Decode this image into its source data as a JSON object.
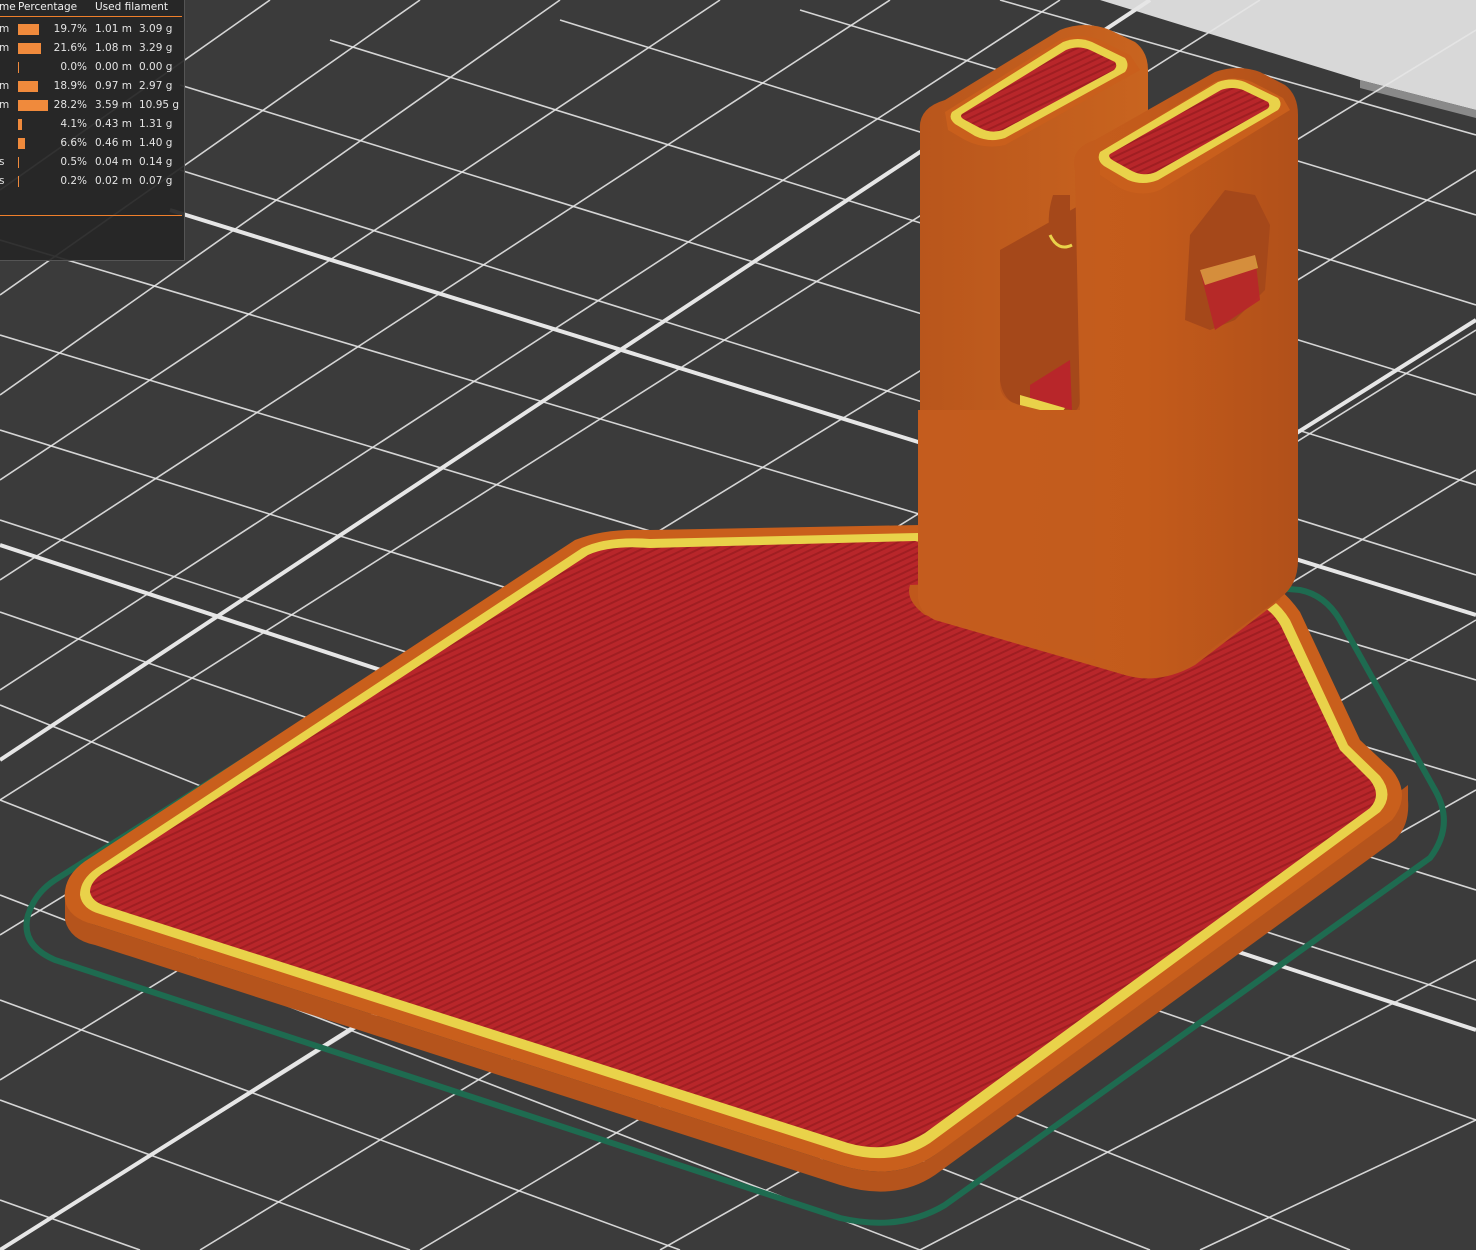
{
  "stats_panel": {
    "columns": {
      "time_partial": "me",
      "percentage": "Percentage",
      "used_filament": "Used filament"
    },
    "rows": [
      {
        "prefix": "m",
        "percentage": "19.7%",
        "length": "1.01 m",
        "weight": "3.09 g",
        "fraction": 0.197
      },
      {
        "prefix": "m",
        "percentage": "21.6%",
        "length": "1.08 m",
        "weight": "3.29 g",
        "fraction": 0.216
      },
      {
        "prefix": "",
        "percentage": "0.0%",
        "length": "0.00 m",
        "weight": "0.00 g",
        "fraction": 0.0
      },
      {
        "prefix": "m",
        "percentage": "18.9%",
        "length": "0.97 m",
        "weight": "2.97 g",
        "fraction": 0.189
      },
      {
        "prefix": "m",
        "percentage": "28.2%",
        "length": "3.59 m",
        "weight": "10.95 g",
        "fraction": 0.282
      },
      {
        "prefix": "",
        "percentage": "4.1%",
        "length": "0.43 m",
        "weight": "1.31 g",
        "fraction": 0.041
      },
      {
        "prefix": "",
        "percentage": "6.6%",
        "length": "0.46 m",
        "weight": "1.40 g",
        "fraction": 0.066
      },
      {
        "prefix": "s",
        "percentage": "0.5%",
        "length": "0.04 m",
        "weight": "0.14 g",
        "fraction": 0.005
      },
      {
        "prefix": "s",
        "percentage": "0.2%",
        "length": "0.02 m",
        "weight": "0.07 g",
        "fraction": 0.002
      }
    ]
  },
  "colors": {
    "bed": "#3b3b3b",
    "grid_line": "#e8e8e8",
    "perimeter": "#c95f1c",
    "perimeter_dark": "#a84c14",
    "inner_wall": "#e9d24a",
    "solid_infill": "#b8262a",
    "skirt": "#1e6b50",
    "accent": "#f08a3c",
    "panel_bg": "#262626"
  }
}
